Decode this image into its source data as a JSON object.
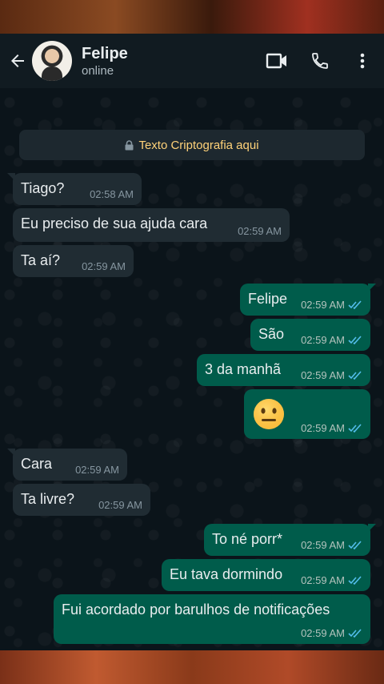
{
  "colors": {
    "header_bg": "#111b21",
    "chat_bg": "#0b141a",
    "incoming_bubble": "#202c33",
    "outgoing_bubble": "#005c4b",
    "read_ticks": "#53bdeb",
    "encryption_text": "#ffd279"
  },
  "header": {
    "back_icon": "arrow-left-icon",
    "contact_name": "Felipe",
    "contact_status": "online",
    "video_icon": "video-camera-icon",
    "call_icon": "phone-icon",
    "menu_icon": "more-vertical-icon"
  },
  "encryption_notice": {
    "icon": "lock-icon",
    "text": "Texto Criptografia aqui"
  },
  "messages": [
    {
      "direction": "in",
      "text": "Tiago?",
      "time": "02:58 AM"
    },
    {
      "direction": "in",
      "text": "Eu preciso de sua ajuda cara",
      "time": "02:59 AM"
    },
    {
      "direction": "in",
      "text": "Ta aí?",
      "time": "02:59 AM"
    },
    {
      "direction": "out",
      "text": "Felipe",
      "time": "02:59 AM",
      "status": "read"
    },
    {
      "direction": "out",
      "text": "São",
      "time": "02:59 AM",
      "status": "read"
    },
    {
      "direction": "out",
      "text": "3 da manhã",
      "time": "02:59 AM",
      "status": "read"
    },
    {
      "direction": "out",
      "emoji": "neutral-face-emoji",
      "time": "02:59 AM",
      "status": "read"
    },
    {
      "direction": "in",
      "text": "Cara",
      "time": "02:59 AM"
    },
    {
      "direction": "in",
      "text": "Ta livre?",
      "time": "02:59 AM"
    },
    {
      "direction": "out",
      "text": "To né porr*",
      "time": "02:59 AM",
      "status": "read"
    },
    {
      "direction": "out",
      "text": "Eu tava dormindo",
      "time": "02:59 AM",
      "status": "read"
    },
    {
      "direction": "out",
      "text": "Fui acordado por barulhos de notificações",
      "time": "02:59 AM",
      "status": "read"
    }
  ]
}
